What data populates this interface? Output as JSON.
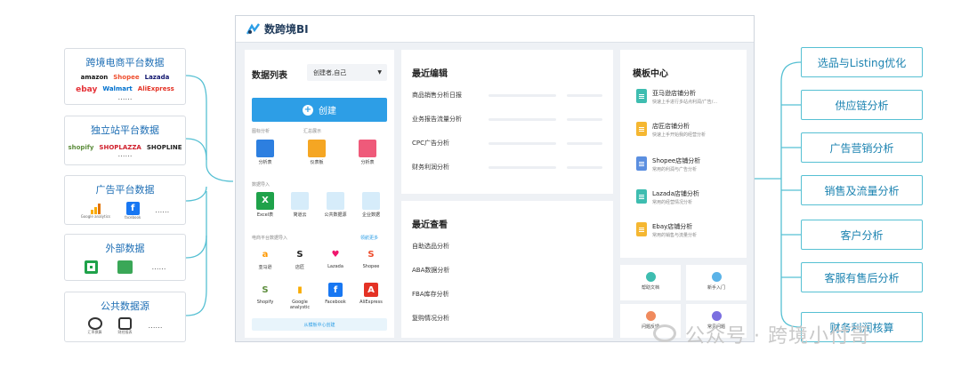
{
  "sources": [
    {
      "title": "跨境电商平台数据",
      "logos": [
        "amazon",
        "Shopee",
        "Lazada",
        "ebay",
        "Walmart",
        "AliExpress"
      ],
      "more": "……"
    },
    {
      "title": "独立站平台数据",
      "logos": [
        "shopify",
        "SHOPLAZZA",
        "SHOPLINE"
      ],
      "more": "……"
    },
    {
      "title": "广告平台数据",
      "logos": [
        "Google analytics",
        "facebook"
      ],
      "more": "……"
    },
    {
      "title": "外部数据",
      "more": "……"
    },
    {
      "title": "公共数据源",
      "logos": [
        "汇率换算",
        "财经报表"
      ],
      "more": "……"
    }
  ],
  "targets": [
    "选品与Listing优化",
    "供应链分析",
    "广告营销分析",
    "销售及流量分析",
    "客户分析",
    "客服有售后分析",
    "财务利润核算"
  ],
  "app": {
    "brand": "数跨境BI",
    "data_list": {
      "title": "数据列表",
      "filter": "创建者,自己",
      "create_label": "创建",
      "sec_chart": "图标分析",
      "sec_summary": "汇总展示",
      "tools_top": [
        "分析表",
        "仪表板",
        "分析表"
      ],
      "sec_import": "数据导入",
      "tools_import": [
        "Excel表",
        "简道云",
        "公共数据源",
        "企业数据"
      ],
      "sec_ecom": "电商平台数据导入",
      "more_link": "领航更多",
      "platforms": [
        "亚马逊",
        "店匠",
        "Lazada",
        "Shopee",
        "Shopify",
        "Google analystic",
        "Facebook",
        "AliExpress"
      ],
      "from_template": "从模板中心创建"
    },
    "recent_edit": {
      "title": "最近编辑",
      "items": [
        "商品销售分析日报",
        "业务报告流量分析",
        "CPC广告分析",
        "财务利润分析"
      ]
    },
    "recent_view": {
      "title": "最近查看",
      "items": [
        "自助选品分析",
        "ABA数据分析",
        "FBA库存分析",
        "复购情况分析"
      ]
    },
    "templates": {
      "title": "模板中心",
      "items": [
        {
          "name": "亚马逊店铺分析",
          "desc": "快速上手进行多站点利润/广告/...",
          "color": "#3ebdb0"
        },
        {
          "name": "店匠店铺分析",
          "desc": "快速上手开始我的经营分析",
          "color": "#f5b731"
        },
        {
          "name": "Shopee店铺分析",
          "desc": "常用的利润与广告分析",
          "color": "#5b8fe0"
        },
        {
          "name": "Lazada店铺分析",
          "desc": "常用的经营情况分析",
          "color": "#3ebdb0"
        },
        {
          "name": "Ebay店铺分析",
          "desc": "常用的销售与流量分析",
          "color": "#f5b731"
        }
      ]
    },
    "help": [
      "帮助文档",
      "新手入门",
      "问题反馈",
      "常见问题"
    ]
  },
  "watermark": "公众号 · 跨境小付哥",
  "colors": {
    "line": "#56c0d3",
    "primary": "#2d9ee6",
    "title_blue": "#1f6fb5"
  }
}
